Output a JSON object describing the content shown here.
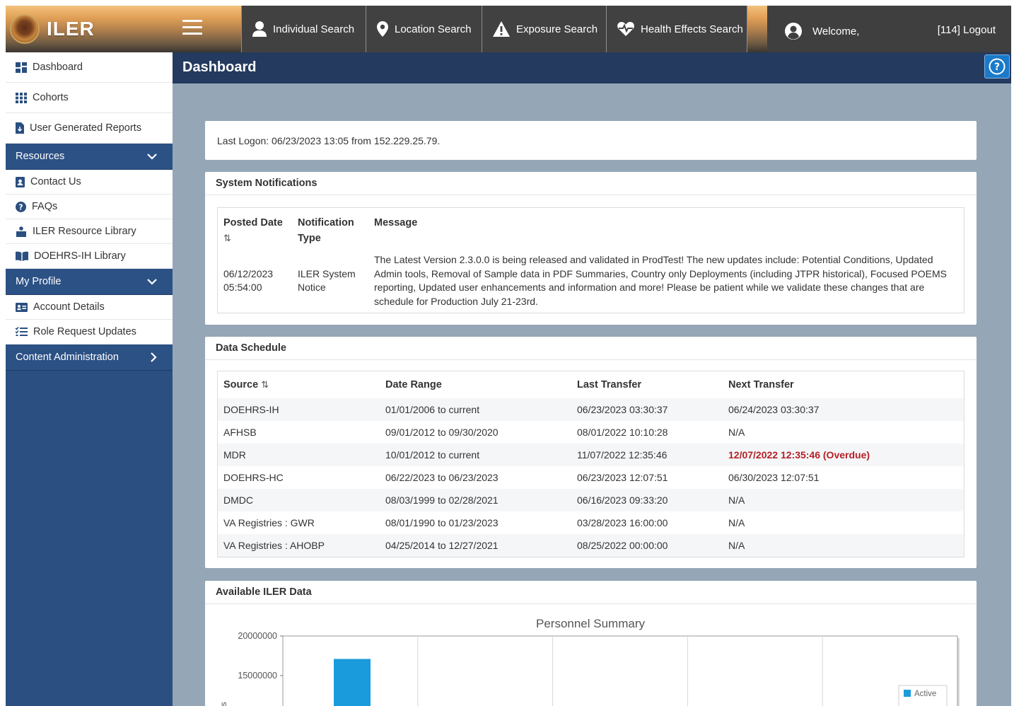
{
  "app": {
    "name": "ILER"
  },
  "topnav": {
    "individual_search": "Individual Search",
    "location_search": "Location Search",
    "exposure_search": "Exposure Search",
    "health_effects_search": "Health Effects Search",
    "welcome": "Welcome,",
    "logout": "[114] Logout"
  },
  "sidebar": {
    "dashboard": "Dashboard",
    "cohorts": "Cohorts",
    "user_generated_reports": "User Generated Reports",
    "resources_header": "Resources",
    "contact_us": "Contact Us",
    "faqs": "FAQs",
    "resource_library": "ILER Resource Library",
    "doehrs_library": "DOEHRS-IH Library",
    "my_profile_header": "My Profile",
    "account_details": "Account Details",
    "role_request_updates": "Role Request Updates",
    "content_admin_header": "Content Administration"
  },
  "page": {
    "title": "Dashboard"
  },
  "last_logon": "Last Logon: 06/23/2023 13:05 from 152.229.25.79.",
  "notifications": {
    "title": "System Notifications",
    "headers": {
      "posted_date": "Posted Date",
      "sort_icon": "⇅",
      "type": "Notification Type",
      "message": "Message"
    },
    "rows": [
      {
        "date": "06/12/2023",
        "time": "05:54:00",
        "type": "ILER System Notice",
        "message": "The Latest Version 2.3.0.0 is being released and validated in ProdTest! The new updates include: Potential Conditions, Updated Admin tools, Removal of Sample data in PDF Summaries, Country only Deployments (including JTPR historical), Focused POEMS reporting, Updated user enhancements and information and more! Please be patient while we validate these changes that are schedule for Production July 21-23rd."
      }
    ]
  },
  "schedule": {
    "title": "Data Schedule",
    "headers": {
      "source": "Source",
      "sort_icon": "⇅",
      "date_range": "Date Range",
      "last_transfer": "Last Transfer",
      "next_transfer": "Next Transfer"
    },
    "rows": [
      {
        "source": "DOEHRS-IH",
        "range": "01/01/2006 to current",
        "last": "06/23/2023 03:30:37",
        "next": "06/24/2023 03:30:37"
      },
      {
        "source": "AFHSB",
        "range": "09/01/2012 to 09/30/2020",
        "last": "08/01/2022 10:10:28",
        "next": "N/A"
      },
      {
        "source": "MDR",
        "range": "10/01/2012 to current",
        "last": "11/07/2022 12:35:46",
        "next": "12/07/2022 12:35:46 (Overdue)"
      },
      {
        "source": "DOEHRS-HC",
        "range": "06/22/2023 to 06/23/2023",
        "last": "06/23/2023 12:07:51",
        "next": "06/30/2023 12:07:51"
      },
      {
        "source": "DMDC",
        "range": "08/03/1999 to 02/28/2021",
        "last": "06/16/2023 09:33:20",
        "next": "N/A"
      },
      {
        "source": "VA Registries : GWR",
        "range": "08/01/1990 to 01/23/2023",
        "last": "03/28/2023 16:00:00",
        "next": "N/A"
      },
      {
        "source": "VA Registries : AHOBP",
        "range": "04/25/2014 to 12/27/2021",
        "last": "08/25/2022 00:00:00",
        "next": "N/A"
      }
    ]
  },
  "available": {
    "title": "Available ILER Data"
  },
  "chart_data": {
    "type": "bar",
    "title": "Personnel Summary",
    "ylim": [
      0,
      20000000
    ],
    "y_ticks": [
      "20000000",
      "15000000"
    ],
    "ylabel_fragment": "es",
    "series": [
      {
        "name": "Active",
        "color": "#1a9bdc",
        "values": [
          17100000
        ]
      }
    ],
    "legend_position": "right",
    "grid": true
  },
  "colors": {
    "sidebar": "#2a4f80",
    "page_header": "#243a5e",
    "content_bg": "#95a7b6",
    "overdue": "#b52025",
    "help": "#1b7ac8"
  }
}
